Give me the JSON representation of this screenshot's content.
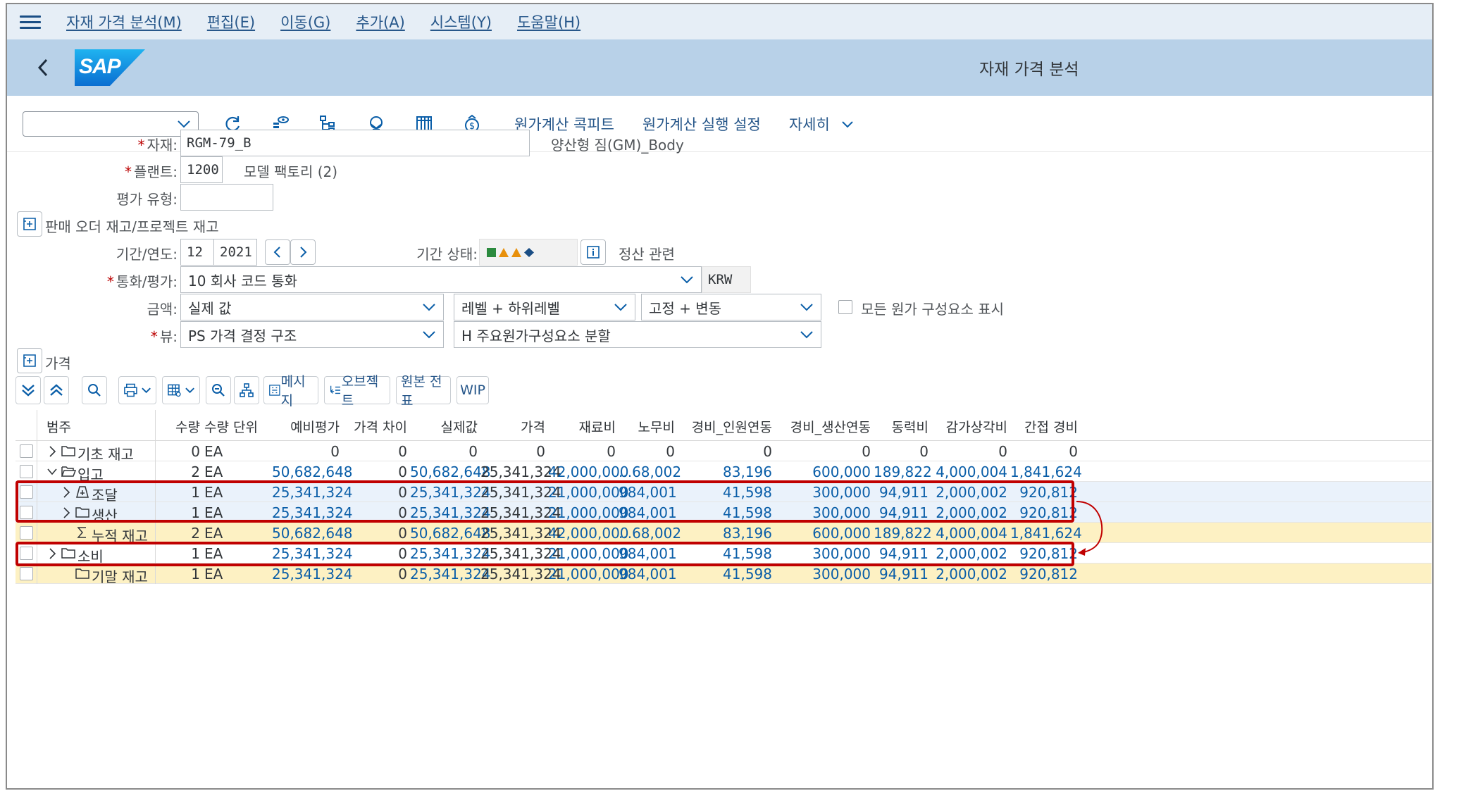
{
  "menu": {
    "items": [
      "자재 가격 분석(M)",
      "편집(E)",
      "이동(G)",
      "추가(A)",
      "시스템(Y)",
      "도움말(H)"
    ]
  },
  "shell": {
    "logo": "SAP",
    "title": "자재 가격 분석"
  },
  "toolbar": {
    "variant_value": "",
    "text_buttons": [
      "원가계산 콕피트",
      "원가계산 실행 설정",
      "자세히"
    ],
    "icons": [
      "refresh-icon",
      "display-structure-icon",
      "hierarchy-icon",
      "cost-component-icon",
      "table-icon",
      "price-icon"
    ]
  },
  "form": {
    "material_label": "자재:",
    "material_value": "RGM-79_B",
    "material_desc": "양산형 짐(GM)_Body",
    "plant_label": "플랜트:",
    "plant_value": "1200",
    "plant_desc": "모델 팩토리 (2)",
    "valuation_type_label": "평가 유형:",
    "valuation_type_value": "",
    "sales_order_section": "판매 오더 재고/프로젝트 재고",
    "period_label": "기간/연도:",
    "period_value": "12",
    "year_value": "2021",
    "period_status_label": "기간 상태:",
    "settlement_label": "정산 관련",
    "currency_label": "통화/평가:",
    "currency_value": "10 회사 코드 통화",
    "currency_code": "KRW",
    "amount_label": "금액:",
    "amount_value": "실제 값",
    "level_value": "레벨 + 하위레벨",
    "fixvar_value": "고정 + 변동",
    "show_all_components_label": "모든 원가 구성요소 표시",
    "view_label": "뷰:",
    "view_value": "PS 가격 결정 구조",
    "view2_value": "H 주요원가구성요소 분할",
    "price_section": "가격"
  },
  "grid_toolbar": {
    "message_label": "메시지",
    "object_label": "오브젝트",
    "original_doc_label": "원본 전표",
    "wip_label": "WIP"
  },
  "colors": {
    "accent": "#0a6ed1",
    "highlight": "#c00000",
    "sum_row": "#fdf1c3",
    "selected_row": "#eaf2fb"
  },
  "table": {
    "headers": [
      "범주",
      "수량",
      "수량 단위",
      "예비평가",
      "가격 차이",
      "실제값",
      "가격",
      "재료비",
      "노무비",
      "경비_인원연동",
      "경비_생산연동",
      "동력비",
      "감가상각비",
      "간접 경비"
    ],
    "rows": [
      {
        "indent": 0,
        "expander": ">",
        "icon": "folder-icon",
        "label": "기초 재고",
        "qty": "0",
        "unit": "EA",
        "prelim": "0",
        "price_diff": "0",
        "actual": "0",
        "price": "0",
        "material": "0",
        "labor": "0",
        "exp_person": "0",
        "exp_prod": "0",
        "power": "0",
        "depr": "0",
        "overhead": "0",
        "style": "white",
        "color": "plain"
      },
      {
        "indent": 0,
        "expander": "v",
        "icon": "folder-open-icon",
        "label": "입고",
        "qty": "2",
        "unit": "EA",
        "prelim": "50,682,648",
        "price_diff": "0",
        "actual": "50,682,648",
        "price": "25,341,324",
        "material": "42,000,000",
        "labor": "...68,002",
        "exp_person": "83,196",
        "exp_prod": "600,000",
        "power": "189,822",
        "depr": "4,000,004",
        "overhead": "1,841,624",
        "style": "white",
        "color": "blue"
      },
      {
        "indent": 1,
        "expander": ">",
        "icon": "procurement-icon",
        "label": "조달",
        "qty": "1",
        "unit": "EA",
        "prelim": "25,341,324",
        "price_diff": "0",
        "actual": "25,341,324",
        "price": "25,341,324",
        "material": "21,000,000",
        "labor": "984,001",
        "exp_person": "41,598",
        "exp_prod": "300,000",
        "power": "94,911",
        "depr": "2,000,002",
        "overhead": "920,812",
        "style": "selected",
        "color": "blue"
      },
      {
        "indent": 1,
        "expander": ">",
        "icon": "folder-icon",
        "label": "생산",
        "qty": "1",
        "unit": "EA",
        "prelim": "25,341,324",
        "price_diff": "0",
        "actual": "25,341,324",
        "price": "25,341,324",
        "material": "21,000,000",
        "labor": "984,001",
        "exp_person": "41,598",
        "exp_prod": "300,000",
        "power": "94,911",
        "depr": "2,000,002",
        "overhead": "920,812",
        "style": "selected",
        "color": "blue"
      },
      {
        "indent": 1,
        "expander": "",
        "icon": "sum-icon",
        "label": "누적 재고",
        "qty": "2",
        "unit": "EA",
        "prelim": "50,682,648",
        "price_diff": "0",
        "actual": "50,682,648",
        "price": "25,341,324",
        "material": "42,000,000",
        "labor": "...68,002",
        "exp_person": "83,196",
        "exp_prod": "600,000",
        "power": "189,822",
        "depr": "4,000,004",
        "overhead": "1,841,624",
        "style": "sum",
        "color": "blue"
      },
      {
        "indent": 0,
        "expander": ">",
        "icon": "folder-icon",
        "label": "소비",
        "qty": "1",
        "unit": "EA",
        "prelim": "25,341,324",
        "price_diff": "0",
        "actual": "25,341,324",
        "price": "25,341,324",
        "material": "21,000,000",
        "labor": "984,001",
        "exp_person": "41,598",
        "exp_prod": "300,000",
        "power": "94,911",
        "depr": "2,000,002",
        "overhead": "920,812",
        "style": "white",
        "color": "blue"
      },
      {
        "indent": 1,
        "expander": "",
        "icon": "folder-icon",
        "label": "기말 재고",
        "qty": "1",
        "unit": "EA",
        "prelim": "25,341,324",
        "price_diff": "0",
        "actual": "25,341,324",
        "price": "25,341,324",
        "material": "21,000,000",
        "labor": "984,001",
        "exp_person": "41,598",
        "exp_prod": "300,000",
        "power": "94,911",
        "depr": "2,000,002",
        "overhead": "920,812",
        "style": "sum",
        "color": "blue"
      }
    ]
  }
}
